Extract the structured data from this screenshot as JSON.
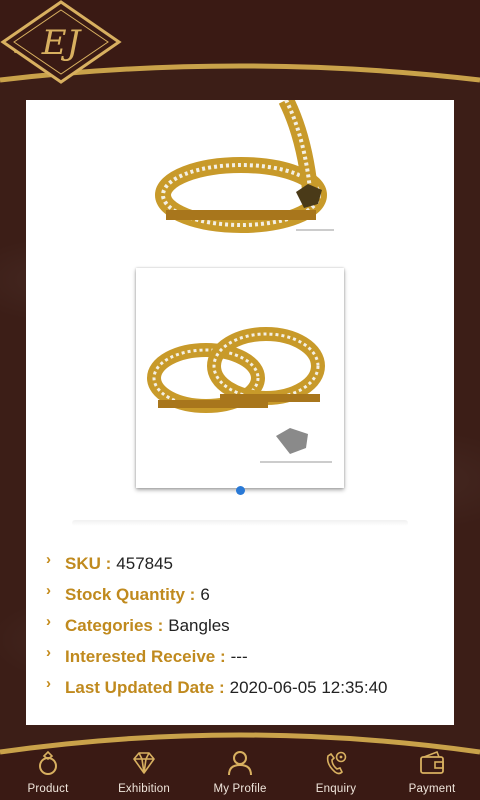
{
  "header": {
    "logo_text": "EJ",
    "menu_icon": "hamburger-menu-icon"
  },
  "gallery": {
    "active_index": 0,
    "accent_color": "#2979d6"
  },
  "details": [
    {
      "label": "SKU :",
      "value": "457845"
    },
    {
      "label": "Stock Quantity :",
      "value": "6"
    },
    {
      "label": "Categories :",
      "value": "Bangles"
    },
    {
      "label": "Interested Receive :",
      "value": "---"
    },
    {
      "label": "Last Updated Date :",
      "value": "2020-06-05 12:35:40"
    }
  ],
  "bottom_nav": [
    {
      "label": "Product",
      "icon": "ring-icon"
    },
    {
      "label": "Exhibition",
      "icon": "diamond-icon"
    },
    {
      "label": "My Profile",
      "icon": "user-icon"
    },
    {
      "label": "Enquiry",
      "icon": "phone-location-icon"
    },
    {
      "label": "Payment",
      "icon": "wallet-icon"
    }
  ],
  "colors": {
    "brand_brown": "#3c1e17",
    "gold": "#c9a24a",
    "label_gold": "#c08a1e"
  }
}
